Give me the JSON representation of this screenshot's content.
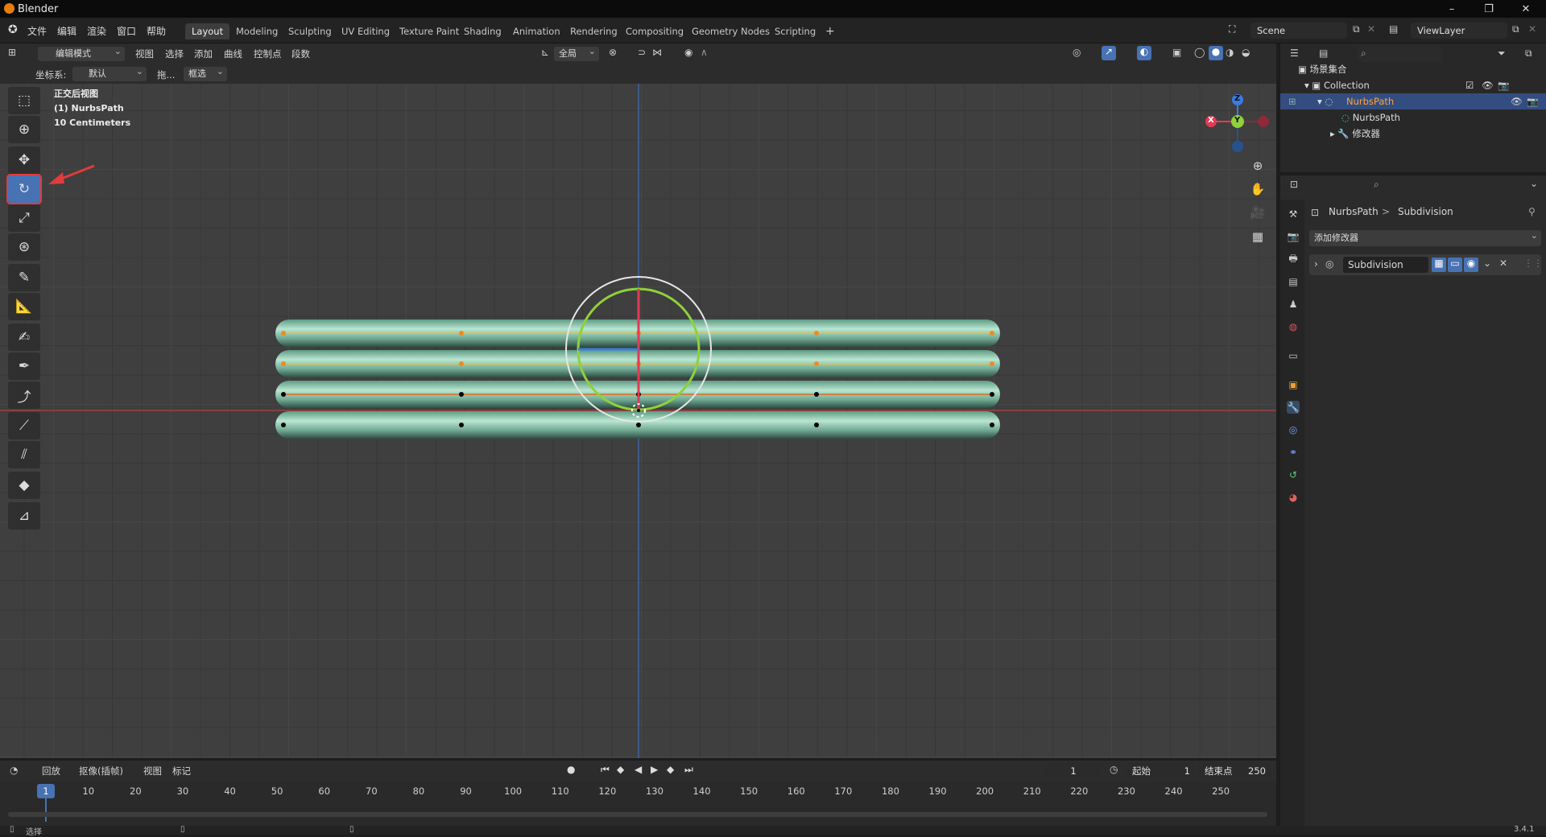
{
  "app": {
    "title": "Blender"
  },
  "menu": [
    "文件",
    "编辑",
    "渲染",
    "窗口",
    "帮助"
  ],
  "workspaces": [
    {
      "label": "Layout",
      "active": true
    },
    {
      "label": "Modeling"
    },
    {
      "label": "Sculpting"
    },
    {
      "label": "UV Editing"
    },
    {
      "label": "Texture Paint"
    },
    {
      "label": "Shading"
    },
    {
      "label": "Animation"
    },
    {
      "label": "Rendering"
    },
    {
      "label": "Compositing"
    },
    {
      "label": "Geometry Nodes"
    },
    {
      "label": "Scripting"
    }
  ],
  "add_workspace": "+",
  "scene": "Scene",
  "view_layer": "ViewLayer",
  "header3d": {
    "mode": "编辑模式",
    "view": "视图",
    "select": "选择",
    "add": "添加",
    "curve": "曲线",
    "control_points": "控制点",
    "segments": "段数",
    "transform_orient": "全局"
  },
  "header3d2": {
    "coord_label": "坐标系:",
    "coord_value": "默认",
    "drag_label": "拖...",
    "drag_value": "框选"
  },
  "overlay": {
    "view_name": "正交后视图",
    "object": "(1) NurbsPath",
    "scale": "10 Centimeters"
  },
  "gizmo": {
    "z": "Z",
    "y": "Y",
    "x": "X"
  },
  "outliner": {
    "scene_collection": "场景集合",
    "collection": "Collection",
    "object": "NurbsPath",
    "data": "NurbsPath",
    "modifiers": "修改器"
  },
  "properties": {
    "breadcrumb_object": "NurbsPath",
    "breadcrumb_sep": ">",
    "breadcrumb_modifier": "Subdivision",
    "add_modifier": "添加修改器",
    "modifier_name": "Subdivision"
  },
  "timeline": {
    "playback": "回放",
    "keying": "抠像(插帧)",
    "view": "视图",
    "marker": "标记",
    "current_frame": "1",
    "start_label": "起始",
    "start": "1",
    "end_label": "结束点",
    "end": "250",
    "ticks": [
      "1",
      "10",
      "20",
      "30",
      "40",
      "50",
      "60",
      "70",
      "80",
      "90",
      "100",
      "110",
      "120",
      "130",
      "140",
      "150",
      "160",
      "170",
      "180",
      "190",
      "200",
      "210",
      "220",
      "230",
      "240",
      "250"
    ]
  },
  "status": {
    "left": "选择",
    "version": "3.4.1"
  },
  "colors": {
    "accent": "#4772b3",
    "curve_selected": "#e8a33b",
    "tube": "#8fc9ae",
    "highlight": "#e23b3b"
  }
}
